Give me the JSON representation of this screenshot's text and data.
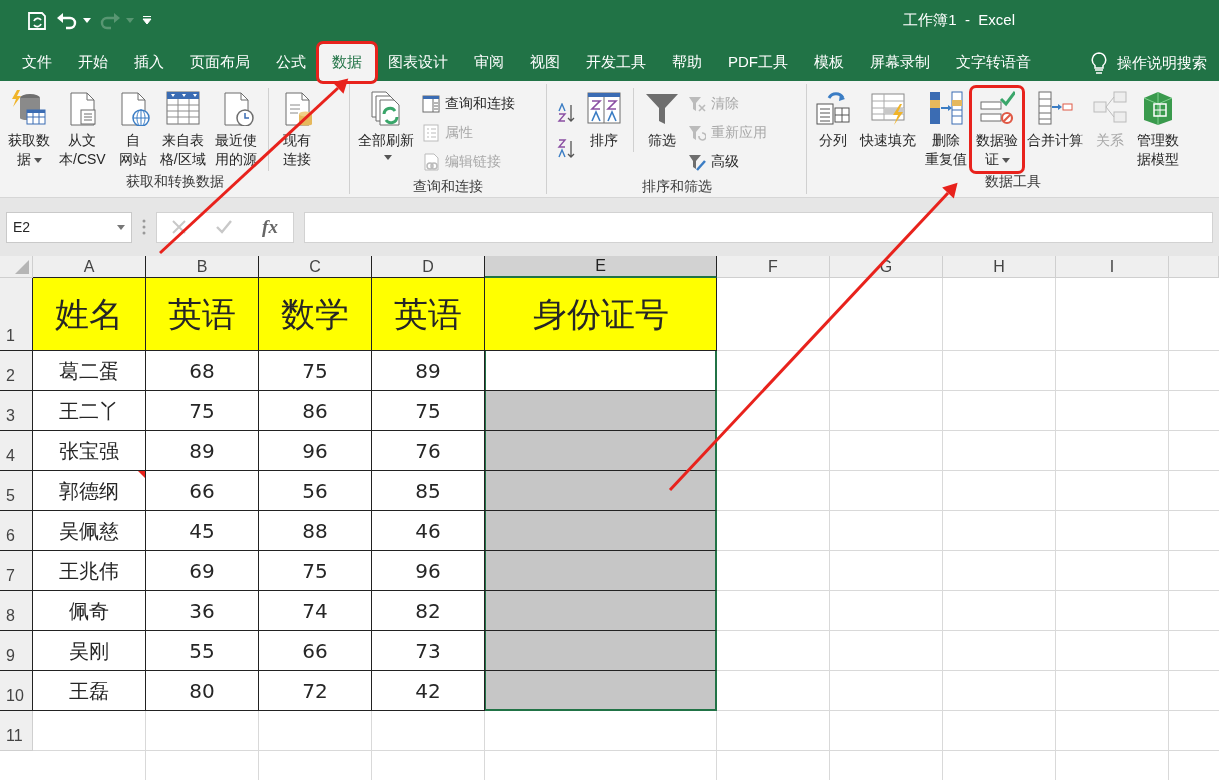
{
  "title_bar": {
    "title": "工作簿1  -  Excel",
    "quick_access": [
      {
        "kind": "save",
        "disabled": false
      },
      {
        "kind": "undo",
        "disabled": false
      },
      {
        "kind": "redo",
        "disabled": true
      },
      {
        "kind": "customize",
        "disabled": false
      }
    ]
  },
  "tabs": [
    {
      "label": "文件",
      "selected": false,
      "highlighted": false
    },
    {
      "label": "开始",
      "selected": false,
      "highlighted": false
    },
    {
      "label": "插入",
      "selected": false,
      "highlighted": false
    },
    {
      "label": "页面布局",
      "selected": false,
      "highlighted": false
    },
    {
      "label": "公式",
      "selected": false,
      "highlighted": false
    },
    {
      "label": "数据",
      "selected": true,
      "highlighted": true
    },
    {
      "label": "图表设计",
      "selected": false,
      "highlighted": false
    },
    {
      "label": "审阅",
      "selected": false,
      "highlighted": false
    },
    {
      "label": "视图",
      "selected": false,
      "highlighted": false
    },
    {
      "label": "开发工具",
      "selected": false,
      "highlighted": false
    },
    {
      "label": "帮助",
      "selected": false,
      "highlighted": false
    },
    {
      "label": "PDF工具",
      "selected": false,
      "highlighted": false
    },
    {
      "label": "模板",
      "selected": false,
      "highlighted": false
    },
    {
      "label": "屏幕录制",
      "selected": false,
      "highlighted": false
    },
    {
      "label": "文字转语音",
      "selected": false,
      "highlighted": false
    }
  ],
  "tell_me": {
    "label": "操作说明搜索"
  },
  "ribbon": {
    "groups": [
      {
        "label": "获取和转换数据",
        "items": [
          {
            "kind": "large",
            "lines": [
              "获取数",
              "据"
            ],
            "dropdown": true,
            "disabled": false,
            "highlighted": false,
            "separator_before": false
          },
          {
            "kind": "large",
            "lines": [
              "从文",
              "本/CSV"
            ],
            "dropdown": false,
            "disabled": false,
            "highlighted": false,
            "separator_before": false
          },
          {
            "kind": "large",
            "lines": [
              "自",
              "网站"
            ],
            "dropdown": false,
            "disabled": false,
            "highlighted": false,
            "separator_before": false
          },
          {
            "kind": "large",
            "lines": [
              "来自表",
              "格/区域"
            ],
            "dropdown": false,
            "disabled": false,
            "highlighted": false,
            "separator_before": false
          },
          {
            "kind": "large",
            "lines": [
              "最近使",
              "用的源"
            ],
            "dropdown": false,
            "disabled": false,
            "highlighted": false,
            "separator_before": false
          },
          {
            "kind": "large",
            "lines": [
              "现有",
              "连接"
            ],
            "dropdown": false,
            "disabled": false,
            "highlighted": false,
            "separator_before": true
          }
        ]
      },
      {
        "label": "查询和连接",
        "items": [
          {
            "kind": "large",
            "lines": [
              "全部刷新"
            ],
            "dropdown": true,
            "disabled": false,
            "highlighted": false,
            "separator_before": false
          },
          {
            "kind": "small_column",
            "items": [
              {
                "label": "查询和连接",
                "disabled": false
              },
              {
                "label": "属性",
                "disabled": true
              },
              {
                "label": "编辑链接",
                "disabled": true
              }
            ]
          }
        ]
      },
      {
        "label": "排序和筛选",
        "items": [
          {
            "kind": "icon_column",
            "items": [
              {
                "kind": "ascending"
              },
              {
                "kind": "descending"
              }
            ]
          },
          {
            "kind": "large",
            "lines": [
              "排序"
            ],
            "dropdown": false,
            "disabled": false,
            "highlighted": false,
            "separator_before": false
          },
          {
            "kind": "large",
            "lines": [
              "筛选"
            ],
            "dropdown": false,
            "disabled": false,
            "highlighted": false,
            "separator_before": true
          },
          {
            "kind": "small_column",
            "items": [
              {
                "label": "清除",
                "disabled": true
              },
              {
                "label": "重新应用",
                "disabled": true
              },
              {
                "label": "高级",
                "disabled": false
              }
            ]
          }
        ]
      },
      {
        "label": "数据工具",
        "items": [
          {
            "kind": "large",
            "lines": [
              "分列"
            ],
            "dropdown": false,
            "disabled": false,
            "highlighted": false,
            "separator_before": false
          },
          {
            "kind": "large",
            "lines": [
              "快速填充"
            ],
            "dropdown": false,
            "disabled": false,
            "highlighted": false,
            "separator_before": false
          },
          {
            "kind": "large",
            "lines": [
              "删除",
              "重复值"
            ],
            "dropdown": false,
            "disabled": false,
            "highlighted": false,
            "separator_before": false
          },
          {
            "kind": "large",
            "lines": [
              "数据验",
              "证"
            ],
            "dropdown": true,
            "disabled": false,
            "highlighted": true,
            "separator_before": false
          },
          {
            "kind": "large",
            "lines": [
              "合并计算"
            ],
            "dropdown": false,
            "disabled": false,
            "highlighted": false,
            "separator_before": false
          },
          {
            "kind": "large",
            "lines": [
              "关系"
            ],
            "dropdown": false,
            "disabled": true,
            "highlighted": false,
            "separator_before": false
          },
          {
            "kind": "large",
            "lines": [
              "管理数",
              "据模型"
            ],
            "dropdown": false,
            "disabled": false,
            "highlighted": false,
            "separator_before": false
          }
        ]
      }
    ]
  },
  "formula_bar": {
    "name_box": "E2",
    "function_label": "fx"
  },
  "sheet": {
    "columns": [
      {
        "label": "A",
        "selected": false
      },
      {
        "label": "B",
        "selected": false
      },
      {
        "label": "C",
        "selected": false
      },
      {
        "label": "D",
        "selected": false
      },
      {
        "label": "E",
        "selected": true
      },
      {
        "label": "F",
        "selected": false
      },
      {
        "label": "G",
        "selected": false
      },
      {
        "label": "H",
        "selected": false
      },
      {
        "label": "I",
        "selected": false
      }
    ],
    "rows": [
      {
        "label": "1",
        "kind": "header",
        "cells": [
          "姓名",
          "英语",
          "数学",
          "英语",
          "身份证号"
        ],
        "highlighted": false,
        "comment": false
      },
      {
        "label": "2",
        "kind": "data",
        "cells": [
          "葛二蛋",
          "68",
          "75",
          "89"
        ],
        "highlighted": false,
        "comment": false
      },
      {
        "label": "3",
        "kind": "data",
        "cells": [
          "王二丫",
          "75",
          "86",
          "75"
        ],
        "highlighted": true,
        "comment": false
      },
      {
        "label": "4",
        "kind": "data",
        "cells": [
          "张宝强",
          "89",
          "96",
          "76"
        ],
        "highlighted": true,
        "comment": false
      },
      {
        "label": "5",
        "kind": "data",
        "cells": [
          "郭德纲",
          "66",
          "56",
          "85"
        ],
        "highlighted": true,
        "comment": true
      },
      {
        "label": "6",
        "kind": "data",
        "cells": [
          "吴佩慈",
          "45",
          "88",
          "46"
        ],
        "highlighted": true,
        "comment": false
      },
      {
        "label": "7",
        "kind": "data",
        "cells": [
          "王兆伟",
          "69",
          "75",
          "96"
        ],
        "highlighted": true,
        "comment": false
      },
      {
        "label": "8",
        "kind": "data",
        "cells": [
          "佩奇",
          "36",
          "74",
          "82"
        ],
        "highlighted": true,
        "comment": false
      },
      {
        "label": "9",
        "kind": "data",
        "cells": [
          "吴刚",
          "55",
          "66",
          "73"
        ],
        "highlighted": true,
        "comment": false
      },
      {
        "label": "10",
        "kind": "data",
        "cells": [
          "王磊",
          "80",
          "72",
          "42"
        ],
        "highlighted": true,
        "comment": false
      },
      {
        "label": "11",
        "kind": "empty",
        "comment": false
      }
    ]
  },
  "annotations": [
    {
      "kind": "arrow"
    },
    {
      "kind": "arrow"
    }
  ]
}
